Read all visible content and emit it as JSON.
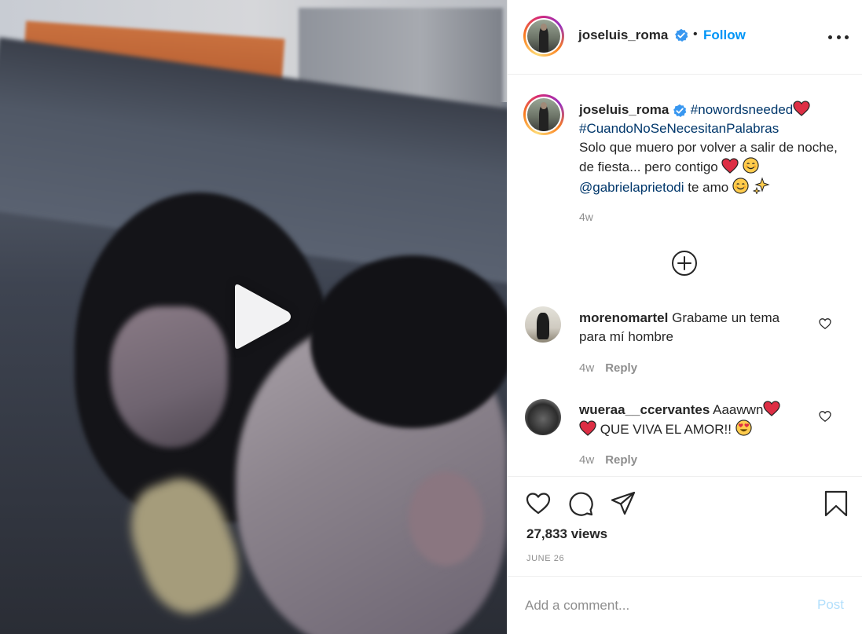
{
  "post": {
    "username": "joseluis_roma",
    "follow_label": "Follow",
    "separator": "•"
  },
  "caption": {
    "username": "joseluis_roma",
    "hashtag1": "#nowordsneeded",
    "hashtag2": "#CuandoNoSeNecesitanPalabras",
    "text1": "Solo que muero por volver a salir de noche, de fiesta... pero contigo",
    "mention": "@gabrielaprietodi",
    "text2": "te amo",
    "time": "4w"
  },
  "comments": [
    {
      "username": "morenomartel",
      "text": "Grabame un tema para mí hombre",
      "time": "4w",
      "reply_label": "Reply"
    },
    {
      "username": "wueraa__ccervantes",
      "text1": "Aaawwn",
      "text2": "QUE VIVA EL AMOR!!",
      "time": "4w",
      "reply_label": "Reply"
    }
  ],
  "stats": {
    "views": "27,833 views",
    "date": "JUNE 26"
  },
  "comment_box": {
    "placeholder": "Add a comment...",
    "post_label": "Post"
  },
  "icons": {
    "play": "play-icon",
    "verified": "verified-badge-icon",
    "more": "more-options-icon",
    "load_more": "plus-circle-icon",
    "like": "heart-icon",
    "comment": "speech-bubble-icon",
    "share": "paper-plane-icon",
    "save": "bookmark-icon"
  },
  "colors": {
    "link": "#0095f6",
    "hashtag": "#00376b",
    "muted": "#8e8e8e",
    "post_disabled": "#b2dffc",
    "heart_emoji": "#e0245e"
  }
}
